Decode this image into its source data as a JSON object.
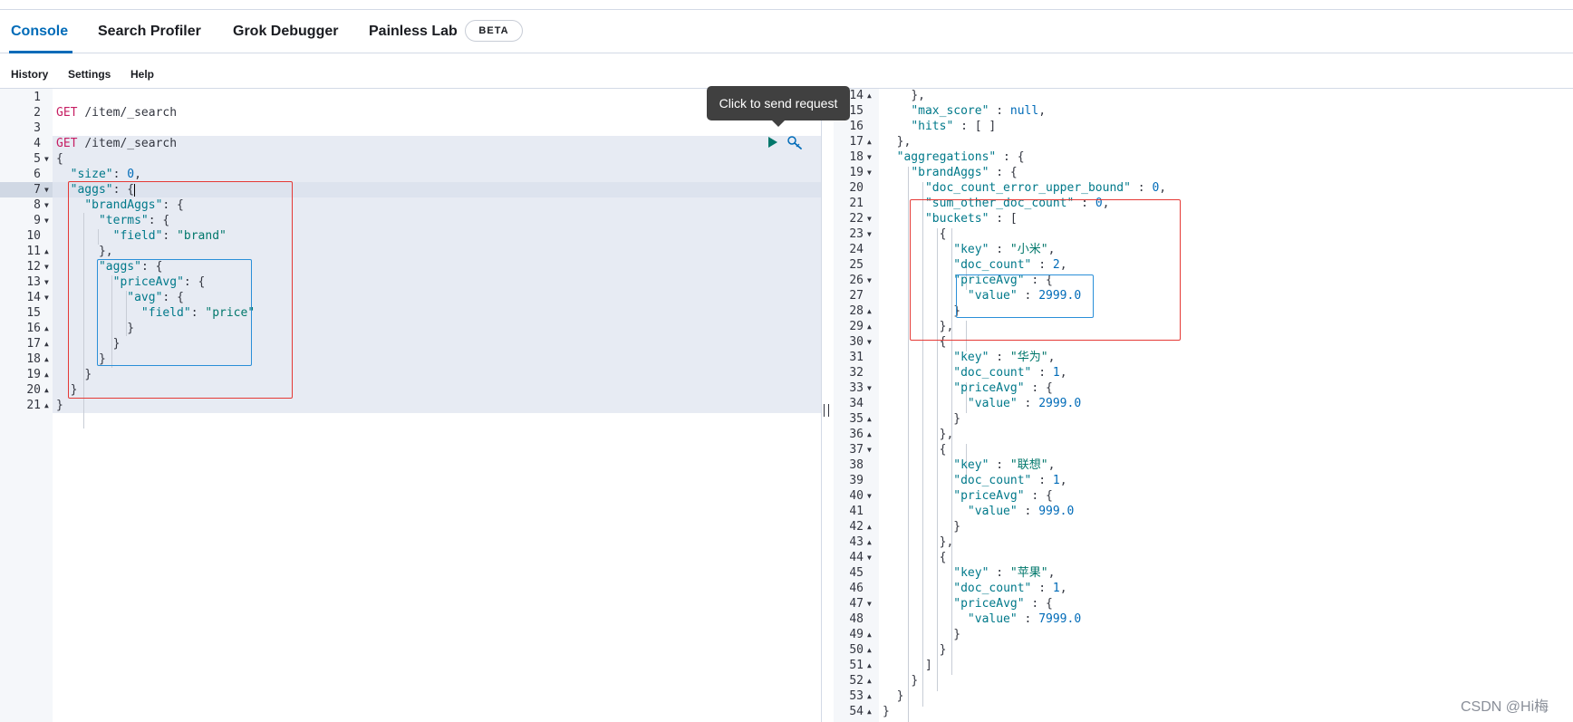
{
  "tabs": [
    {
      "label": "Console",
      "active": true
    },
    {
      "label": "Search Profiler"
    },
    {
      "label": "Grok Debugger"
    },
    {
      "label": "Painless Lab"
    }
  ],
  "beta_badge": "BETA",
  "menu": [
    {
      "label": "History"
    },
    {
      "label": "Settings"
    },
    {
      "label": "Help"
    }
  ],
  "tooltip": "Click to send request",
  "icons": {
    "run": "play-icon",
    "settings": "wrench-icon"
  },
  "request_lines": [
    {
      "n": "1",
      "fold": false,
      "html": ""
    },
    {
      "n": "2",
      "fold": false,
      "html": "<span class='kw'>GET</span> <span class='url'>/item/_search</span>"
    },
    {
      "n": "3",
      "fold": false,
      "html": ""
    },
    {
      "n": "4",
      "fold": false,
      "html": "<span class='kw'>GET</span> <span class='url'>/item/_search</span>"
    },
    {
      "n": "5",
      "fold": "down",
      "html": "<span class='p'>{</span>"
    },
    {
      "n": "6",
      "fold": false,
      "html": "  <span class='k'>\"size\"</span><span class='p'>: </span><span class='n'>0</span><span class='p'>,</span>"
    },
    {
      "n": "7",
      "fold": "down",
      "html": "  <span class='k'>\"aggs\"</span><span class='p'>: {</span><span class='cursor'></span>"
    },
    {
      "n": "8",
      "fold": "down",
      "html": "    <span class='k'>\"brandAggs\"</span><span class='p'>: {</span>"
    },
    {
      "n": "9",
      "fold": "down",
      "html": "      <span class='k'>\"terms\"</span><span class='p'>: {</span>"
    },
    {
      "n": "10",
      "fold": false,
      "html": "        <span class='k'>\"field\"</span><span class='p'>: </span><span class='s'>\"brand\"</span>"
    },
    {
      "n": "11",
      "fold": "up",
      "html": "      <span class='p'>},</span>"
    },
    {
      "n": "12",
      "fold": "down",
      "html": "      <span class='k'>\"aggs\"</span><span class='p'>: {</span>"
    },
    {
      "n": "13",
      "fold": "down",
      "html": "        <span class='k'>\"priceAvg\"</span><span class='p'>: {</span>"
    },
    {
      "n": "14",
      "fold": "down",
      "html": "          <span class='k'>\"avg\"</span><span class='p'>: {</span>"
    },
    {
      "n": "15",
      "fold": false,
      "html": "            <span class='k'>\"field\"</span><span class='p'>: </span><span class='s'>\"price\"</span>"
    },
    {
      "n": "16",
      "fold": "up",
      "html": "          <span class='p'>}</span>"
    },
    {
      "n": "17",
      "fold": "up",
      "html": "        <span class='p'>}</span>"
    },
    {
      "n": "18",
      "fold": "up",
      "html": "      <span class='p'>}</span>"
    },
    {
      "n": "19",
      "fold": "up",
      "html": "    <span class='p'>}</span>"
    },
    {
      "n": "20",
      "fold": "up",
      "html": "  <span class='p'>}</span>"
    },
    {
      "n": "21",
      "fold": "up",
      "html": "<span class='p'>}</span>"
    }
  ],
  "response_lines": [
    {
      "n": "14",
      "fold": "up",
      "html": "    <span class='p'>},</span>"
    },
    {
      "n": "15",
      "fold": false,
      "html": "    <span class='k'>\"max_score\"</span><span class='p'> : </span><span class='n'>null</span><span class='p'>,</span>"
    },
    {
      "n": "16",
      "fold": false,
      "html": "    <span class='k'>\"hits\"</span><span class='p'> : [ ]</span>"
    },
    {
      "n": "17",
      "fold": "up",
      "html": "  <span class='p'>},</span>"
    },
    {
      "n": "18",
      "fold": "down",
      "html": "  <span class='k'>\"aggregations\"</span><span class='p'> : {</span>"
    },
    {
      "n": "19",
      "fold": "down",
      "html": "    <span class='k'>\"brandAggs\"</span><span class='p'> : {</span>"
    },
    {
      "n": "20",
      "fold": false,
      "html": "      <span class='k'>\"doc_count_error_upper_bound\"</span><span class='p'> : </span><span class='n'>0</span><span class='p'>,</span>"
    },
    {
      "n": "21",
      "fold": false,
      "html": "      <span class='k'>\"sum_other_doc_count\"</span><span class='p'> : </span><span class='n'>0</span><span class='p'>,</span>"
    },
    {
      "n": "22",
      "fold": "down",
      "html": "      <span class='k'>\"buckets\"</span><span class='p'> : [</span>"
    },
    {
      "n": "23",
      "fold": "down",
      "html": "        <span class='p'>{</span>"
    },
    {
      "n": "24",
      "fold": false,
      "html": "          <span class='k'>\"key\"</span><span class='p'> : </span><span class='s'>\"小米\"</span><span class='p'>,</span>"
    },
    {
      "n": "25",
      "fold": false,
      "html": "          <span class='k'>\"doc_count\"</span><span class='p'> : </span><span class='n'>2</span><span class='p'>,</span>"
    },
    {
      "n": "26",
      "fold": "down",
      "html": "          <span class='k'>\"priceAvg\"</span><span class='p'> : {</span>"
    },
    {
      "n": "27",
      "fold": false,
      "html": "            <span class='k'>\"value\"</span><span class='p'> : </span><span class='n'>2999.0</span>"
    },
    {
      "n": "28",
      "fold": "up",
      "html": "          <span class='p'>}</span>"
    },
    {
      "n": "29",
      "fold": "up",
      "html": "        <span class='p'>},</span>"
    },
    {
      "n": "30",
      "fold": "down",
      "html": "        <span class='p'>{</span>"
    },
    {
      "n": "31",
      "fold": false,
      "html": "          <span class='k'>\"key\"</span><span class='p'> : </span><span class='s'>\"华为\"</span><span class='p'>,</span>"
    },
    {
      "n": "32",
      "fold": false,
      "html": "          <span class='k'>\"doc_count\"</span><span class='p'> : </span><span class='n'>1</span><span class='p'>,</span>"
    },
    {
      "n": "33",
      "fold": "down",
      "html": "          <span class='k'>\"priceAvg\"</span><span class='p'> : {</span>"
    },
    {
      "n": "34",
      "fold": false,
      "html": "            <span class='k'>\"value\"</span><span class='p'> : </span><span class='n'>2999.0</span>"
    },
    {
      "n": "35",
      "fold": "up",
      "html": "          <span class='p'>}</span>"
    },
    {
      "n": "36",
      "fold": "up",
      "html": "        <span class='p'>},</span>"
    },
    {
      "n": "37",
      "fold": "down",
      "html": "        <span class='p'>{</span>"
    },
    {
      "n": "38",
      "fold": false,
      "html": "          <span class='k'>\"key\"</span><span class='p'> : </span><span class='s'>\"联想\"</span><span class='p'>,</span>"
    },
    {
      "n": "39",
      "fold": false,
      "html": "          <span class='k'>\"doc_count\"</span><span class='p'> : </span><span class='n'>1</span><span class='p'>,</span>"
    },
    {
      "n": "40",
      "fold": "down",
      "html": "          <span class='k'>\"priceAvg\"</span><span class='p'> : {</span>"
    },
    {
      "n": "41",
      "fold": false,
      "html": "            <span class='k'>\"value\"</span><span class='p'> : </span><span class='n'>999.0</span>"
    },
    {
      "n": "42",
      "fold": "up",
      "html": "          <span class='p'>}</span>"
    },
    {
      "n": "43",
      "fold": "up",
      "html": "        <span class='p'>},</span>"
    },
    {
      "n": "44",
      "fold": "down",
      "html": "        <span class='p'>{</span>"
    },
    {
      "n": "45",
      "fold": false,
      "html": "          <span class='k'>\"key\"</span><span class='p'> : </span><span class='s'>\"苹果\"</span><span class='p'>,</span>"
    },
    {
      "n": "46",
      "fold": false,
      "html": "          <span class='k'>\"doc_count\"</span><span class='p'> : </span><span class='n'>1</span><span class='p'>,</span>"
    },
    {
      "n": "47",
      "fold": "down",
      "html": "          <span class='k'>\"priceAvg\"</span><span class='p'> : {</span>"
    },
    {
      "n": "48",
      "fold": false,
      "html": "            <span class='k'>\"value\"</span><span class='p'> : </span><span class='n'>7999.0</span>"
    },
    {
      "n": "49",
      "fold": "up",
      "html": "          <span class='p'>}</span>"
    },
    {
      "n": "50",
      "fold": "up",
      "html": "        <span class='p'>}</span>"
    },
    {
      "n": "51",
      "fold": "up",
      "html": "      <span class='p'>]</span>"
    },
    {
      "n": "52",
      "fold": "up",
      "html": "    <span class='p'>}</span>"
    },
    {
      "n": "53",
      "fold": "up",
      "html": "  <span class='p'>}</span>"
    },
    {
      "n": "54",
      "fold": "up",
      "html": "<span class='p'>}</span>"
    }
  ],
  "watermark": "CSDN @Hi梅",
  "colors": {
    "accent": "#006bb8",
    "annotation_red": "#e53935",
    "annotation_blue": "#2a8fd8",
    "string": "#00776b",
    "key": "#00798a",
    "method": "#c61e63"
  }
}
